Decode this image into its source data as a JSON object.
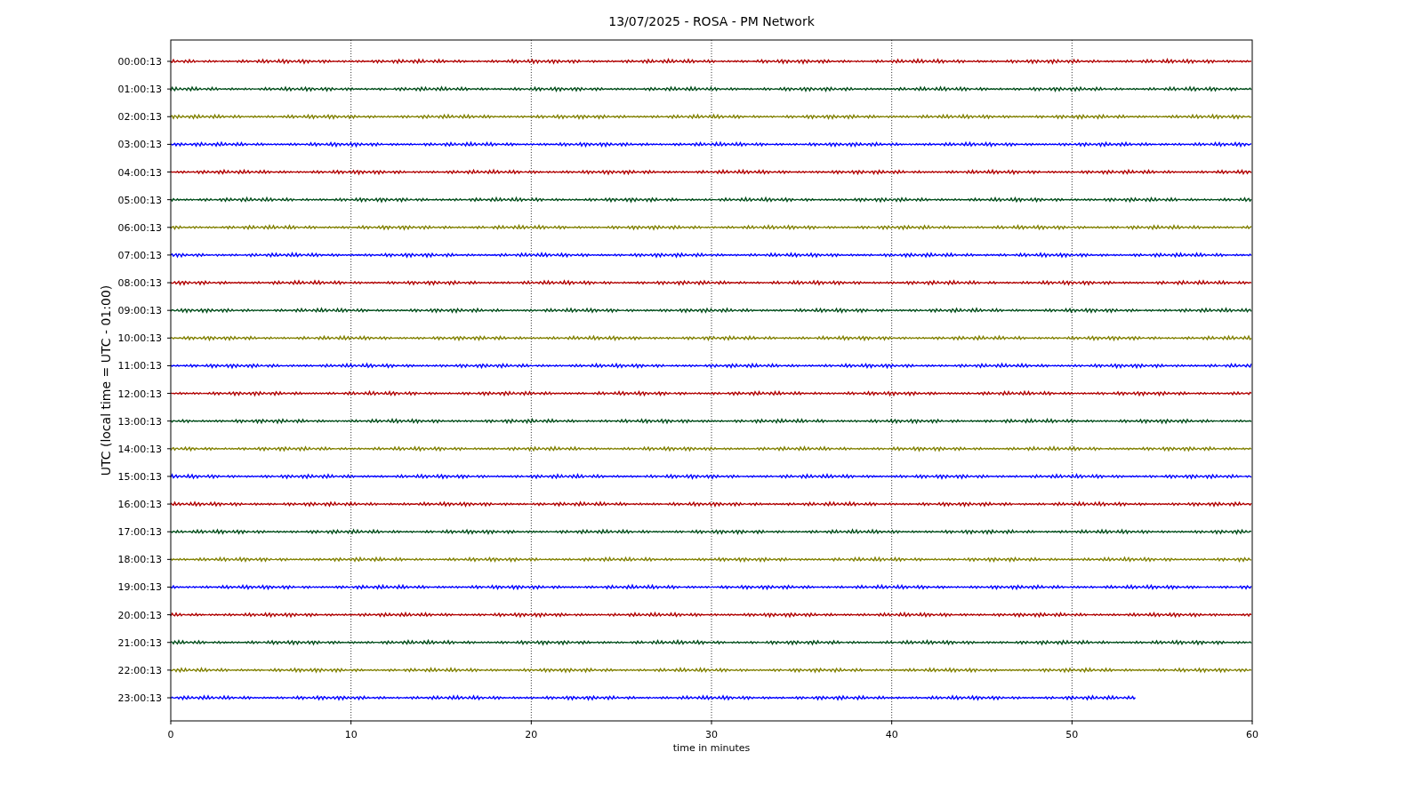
{
  "title": "13/07/2025 - ROSA - PM Network",
  "xlabel": "time in minutes",
  "ylabel": "UTC (local time = UTC - 01:00)",
  "xticks": [
    "0",
    "10",
    "20",
    "30",
    "40",
    "50",
    "60"
  ],
  "traces": [
    {
      "label": "00:00:13",
      "color": "#b00000",
      "level": 1
    },
    {
      "label": "01:00:13",
      "color": "#004d1a",
      "level": 1
    },
    {
      "label": "02:00:13",
      "color": "#808000",
      "level": 1
    },
    {
      "label": "03:00:13",
      "color": "#0000ff",
      "level": 1
    },
    {
      "label": "04:00:13",
      "color": "#b00000",
      "level": 1
    },
    {
      "label": "05:00:13",
      "color": "#004d1a",
      "level": 1
    },
    {
      "label": "06:00:13",
      "color": "#808000",
      "level": 1
    },
    {
      "label": "07:00:13",
      "color": "#0000ff",
      "level": 1
    },
    {
      "label": "08:00:13",
      "color": "#b00000",
      "level": 1
    },
    {
      "label": "09:00:13",
      "color": "#004d1a",
      "level": 1
    },
    {
      "label": "10:00:13",
      "color": "#808000",
      "level": 1
    },
    {
      "label": "11:00:13",
      "color": "#0000ff",
      "level": 1
    },
    {
      "label": "12:00:13",
      "color": "#b00000",
      "level": 1
    },
    {
      "label": "13:00:13",
      "color": "#004d1a",
      "level": 1
    },
    {
      "label": "14:00:13",
      "color": "#808000",
      "level": 1
    },
    {
      "label": "15:00:13",
      "color": "#0000ff",
      "level": 1
    },
    {
      "label": "16:00:13",
      "color": "#b00000",
      "level": 1
    },
    {
      "label": "17:00:13",
      "color": "#004d1a",
      "level": 1
    },
    {
      "label": "18:00:13",
      "color": "#808000",
      "level": 1
    },
    {
      "label": "19:00:13",
      "color": "#0000ff",
      "level": 1
    },
    {
      "label": "20:00:13",
      "color": "#b00000",
      "level": 1
    },
    {
      "label": "21:00:13",
      "color": "#004d1a",
      "level": 1
    },
    {
      "label": "22:00:13",
      "color": "#808000",
      "level": 1
    },
    {
      "label": "23:00:13",
      "color": "#0000ff",
      "level": 0.893
    }
  ]
}
